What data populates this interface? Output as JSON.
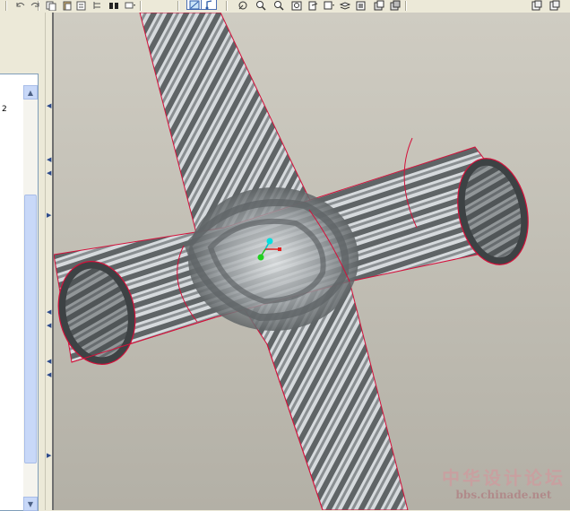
{
  "toolbar": {
    "buttons": [
      {
        "icon": "undo-icon"
      },
      {
        "icon": "redo-icon"
      },
      {
        "icon": "copy-icon"
      },
      {
        "icon": "paste-icon"
      },
      {
        "icon": "paste-special-icon"
      },
      {
        "icon": "model-tree-icon"
      },
      {
        "icon": "find-icon"
      },
      {
        "icon": "selection-dropdown-icon"
      },
      {
        "icon": "repaint-icon",
        "pressed": true
      },
      {
        "icon": "spin-center-icon",
        "pressed": true
      },
      {
        "icon": "orient-icon"
      },
      {
        "icon": "zoom-in-icon"
      },
      {
        "icon": "zoom-out-icon"
      },
      {
        "icon": "refit-icon"
      },
      {
        "icon": "view-manager-icon"
      },
      {
        "icon": "saved-views-icon"
      },
      {
        "icon": "layers-icon"
      },
      {
        "icon": "appearance-icon"
      },
      {
        "icon": "shade-icon"
      },
      {
        "icon": "display-style-icon"
      }
    ]
  },
  "model_tree": {
    "item_text": "2"
  },
  "watermark": {
    "cn": "中华设计论坛",
    "url": "bbs.chinade.net"
  },
  "colors": {
    "surface_dark": "#5f6466",
    "surface_light": "#d6dadd",
    "edge_red": "#d4103a",
    "viewport_bg": "#bdbbb2",
    "toolbar_bg": "#ece9d8",
    "scroll_blue": "#c8d8f8"
  }
}
